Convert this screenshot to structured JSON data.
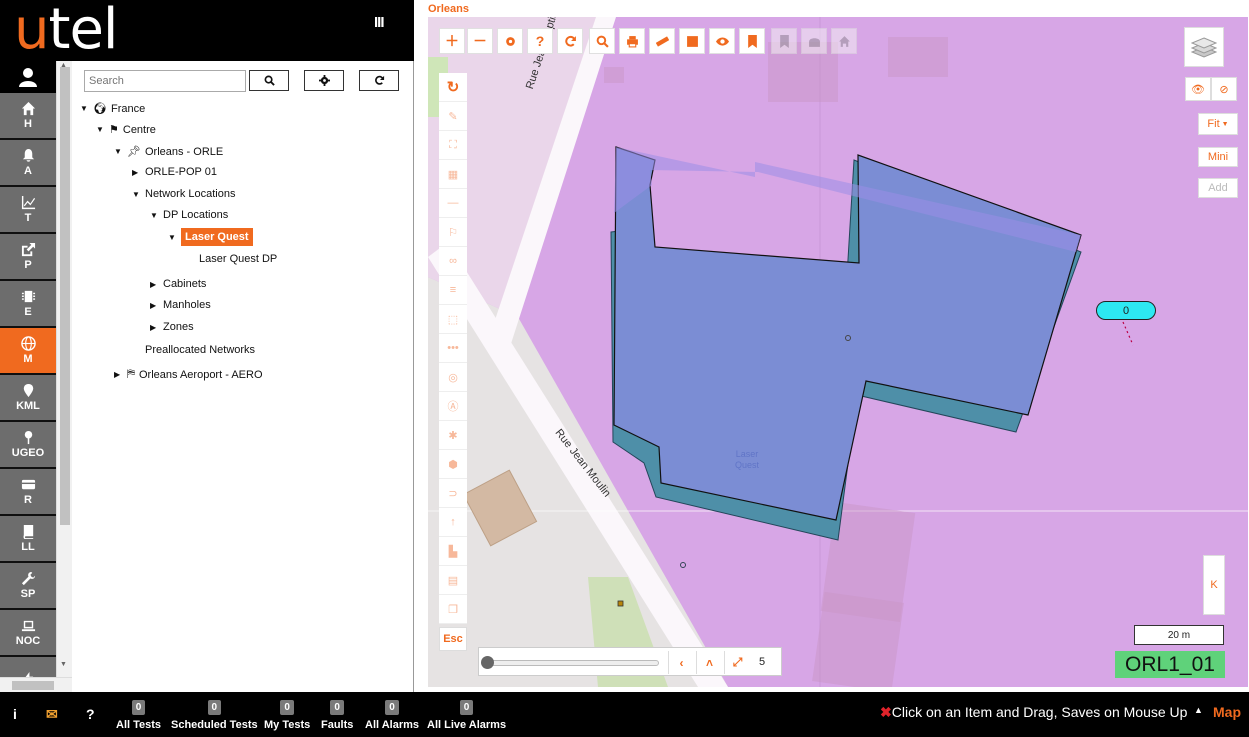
{
  "app": {
    "logo_accent": "u",
    "logo_rest": "tel",
    "menu_toggle": "III",
    "accent_color": "#f06a1f"
  },
  "rail": {
    "items": [
      {
        "label": "H",
        "icon": "home-icon"
      },
      {
        "label": "A",
        "icon": "bell-icon"
      },
      {
        "label": "T",
        "icon": "chart-icon"
      },
      {
        "label": "P",
        "icon": "share-icon"
      },
      {
        "label": "E",
        "icon": "chip-icon"
      },
      {
        "label": "M",
        "icon": "globe-icon",
        "active": true
      },
      {
        "label": "KML",
        "icon": "pin-icon"
      },
      {
        "label": "UGEO",
        "icon": "map-marker-icon"
      },
      {
        "label": "R",
        "icon": "card-icon"
      },
      {
        "label": "LL",
        "icon": "book-icon"
      },
      {
        "label": "SP",
        "icon": "wrench-icon"
      },
      {
        "label": "NOC",
        "icon": "laptop-icon"
      },
      {
        "label": "",
        "icon": "bolt-icon"
      }
    ]
  },
  "tree": {
    "search_placeholder": "Search",
    "nodes": {
      "france": "France",
      "centre": "Centre",
      "orleans": "Orleans - ORLE",
      "orle_pop": "ORLE-POP 01",
      "network_locations": "Network Locations",
      "dp_locations": "DP Locations",
      "laser_quest": "Laser Quest",
      "laser_quest_dp": "Laser Quest DP",
      "cabinets": "Cabinets",
      "manholes": "Manholes",
      "zones": "Zones",
      "preallocated": "Preallocated Networks",
      "aero": "Orleans Aeroport - AERO"
    }
  },
  "map": {
    "title": "Orleans",
    "street_1": "Rue Jean Baptiste Corot",
    "street_2": "Rue Jean Moulin",
    "building_label": "Laser Quest",
    "marker_value": "0",
    "zoom_level": "5",
    "esc_label": "Esc",
    "fit_label": "Fit",
    "mini_label": "Mini",
    "add_label": "Add",
    "k_label": "K",
    "scale_label": "20 m",
    "map_code": "ORL1_01",
    "slider_fraction": 0.0
  },
  "footer": {
    "info": "i",
    "help": "?",
    "stats": [
      {
        "label": "All Tests",
        "count": "0"
      },
      {
        "label": "Scheduled Tests",
        "count": "0"
      },
      {
        "label": "My Tests",
        "count": "0"
      },
      {
        "label": "Faults",
        "count": "0"
      },
      {
        "label": "All Alarms",
        "count": "0"
      },
      {
        "label": "All Live Alarms",
        "count": "0"
      }
    ],
    "message_x": "✖",
    "message": "Click on an Item and Drag, Saves on Mouse Up",
    "caret": "▲",
    "mode": "Map"
  }
}
